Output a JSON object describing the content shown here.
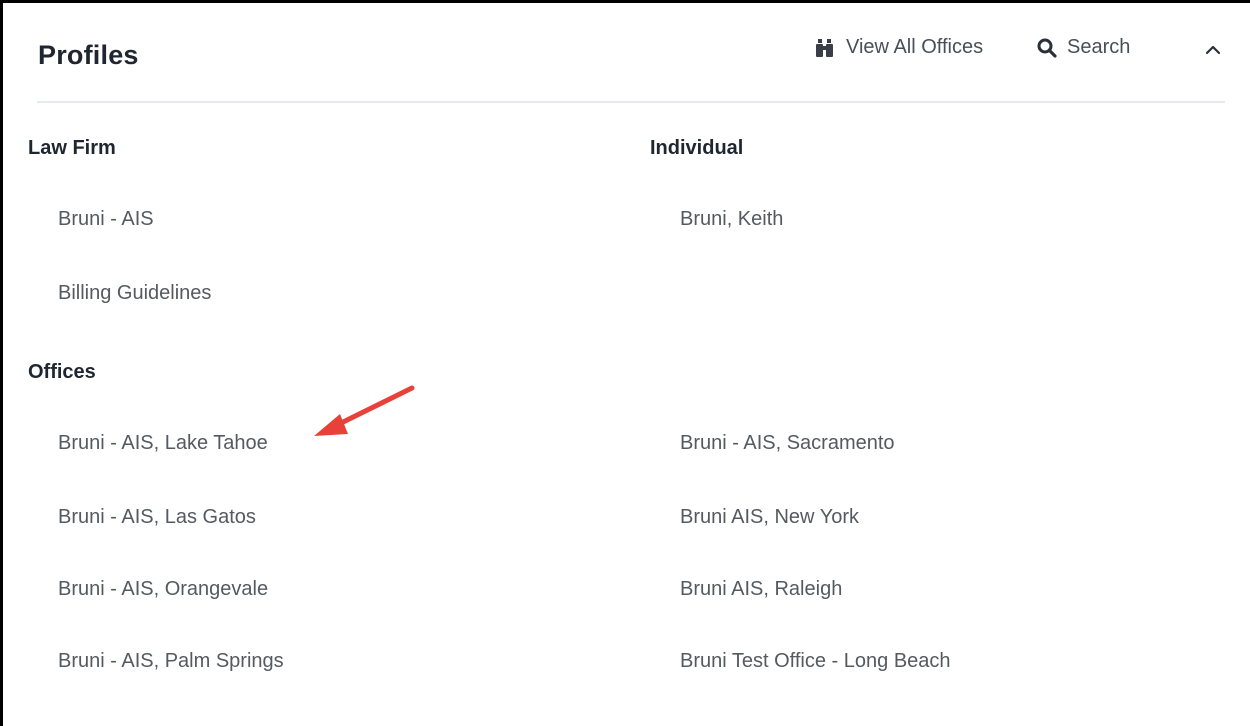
{
  "header": {
    "title": "Profiles",
    "view_all_label": "View All Offices",
    "search_label": "Search",
    "view_all_icon": "binoculars-icon",
    "search_icon": "search-icon",
    "collapse_icon": "chevron-up-icon"
  },
  "law_firm": {
    "heading": "Law Firm",
    "items": [
      "Bruni - AIS",
      "Billing Guidelines"
    ]
  },
  "individual": {
    "heading": "Individual",
    "items": [
      "Bruni, Keith"
    ]
  },
  "offices": {
    "heading": "Offices",
    "left": [
      "Bruni - AIS, Lake Tahoe",
      "Bruni - AIS, Las Gatos",
      "Bruni - AIS, Orangevale",
      "Bruni - AIS, Palm Springs"
    ],
    "right": [
      "Bruni - AIS, Sacramento",
      "Bruni AIS, New York",
      "Bruni AIS, Raleigh",
      "Bruni Test Office - Long Beach"
    ]
  },
  "colors": {
    "heading": "#1f2630",
    "item": "#555a61",
    "annotation_arrow": "#e8413a"
  }
}
